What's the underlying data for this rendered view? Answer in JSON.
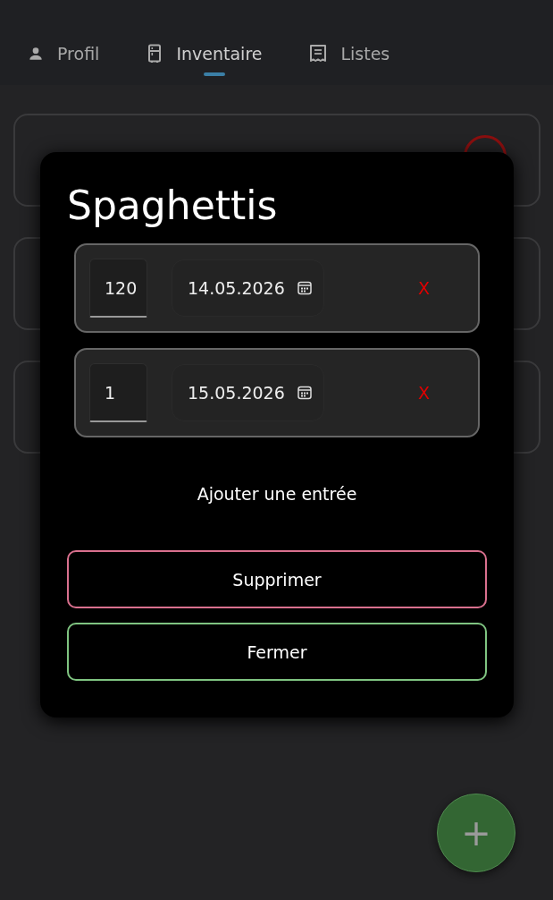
{
  "tabs": [
    {
      "label": "Profil",
      "selected": false
    },
    {
      "label": "Inventaire",
      "selected": true
    },
    {
      "label": "Listes",
      "selected": false
    }
  ],
  "dialog": {
    "title": "Spaghettis",
    "entries": [
      {
        "quantity": "120",
        "date": "14.05.2026",
        "delete": "X"
      },
      {
        "quantity": "1",
        "date": "15.05.2026",
        "delete": "X"
      }
    ],
    "add_entry": "Ajouter une entrée",
    "buttons": [
      {
        "label": "Supprimer",
        "kind": "danger"
      },
      {
        "label": "Fermer",
        "kind": "confirm"
      }
    ]
  },
  "fab": {
    "label": "+"
  }
}
